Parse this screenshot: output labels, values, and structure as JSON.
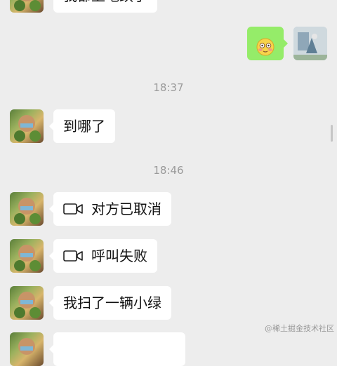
{
  "messages": {
    "top_partial_text": "我都上地跌了",
    "emoji_message_icon": "flushed-face-emoji",
    "time_1": "18:37",
    "where_text": "到哪了",
    "time_2": "18:46",
    "call_cancelled_text": "对方已取消",
    "call_failed_text": "呼叫失败",
    "scanned_bike_text": "我扫了一辆小绿"
  },
  "watermark": "@稀土掘金技术社区",
  "colors": {
    "background": "#ededed",
    "incoming_bubble": "#ffffff",
    "outgoing_bubble": "#95ec69",
    "timestamp_text": "#9a9a9a"
  }
}
